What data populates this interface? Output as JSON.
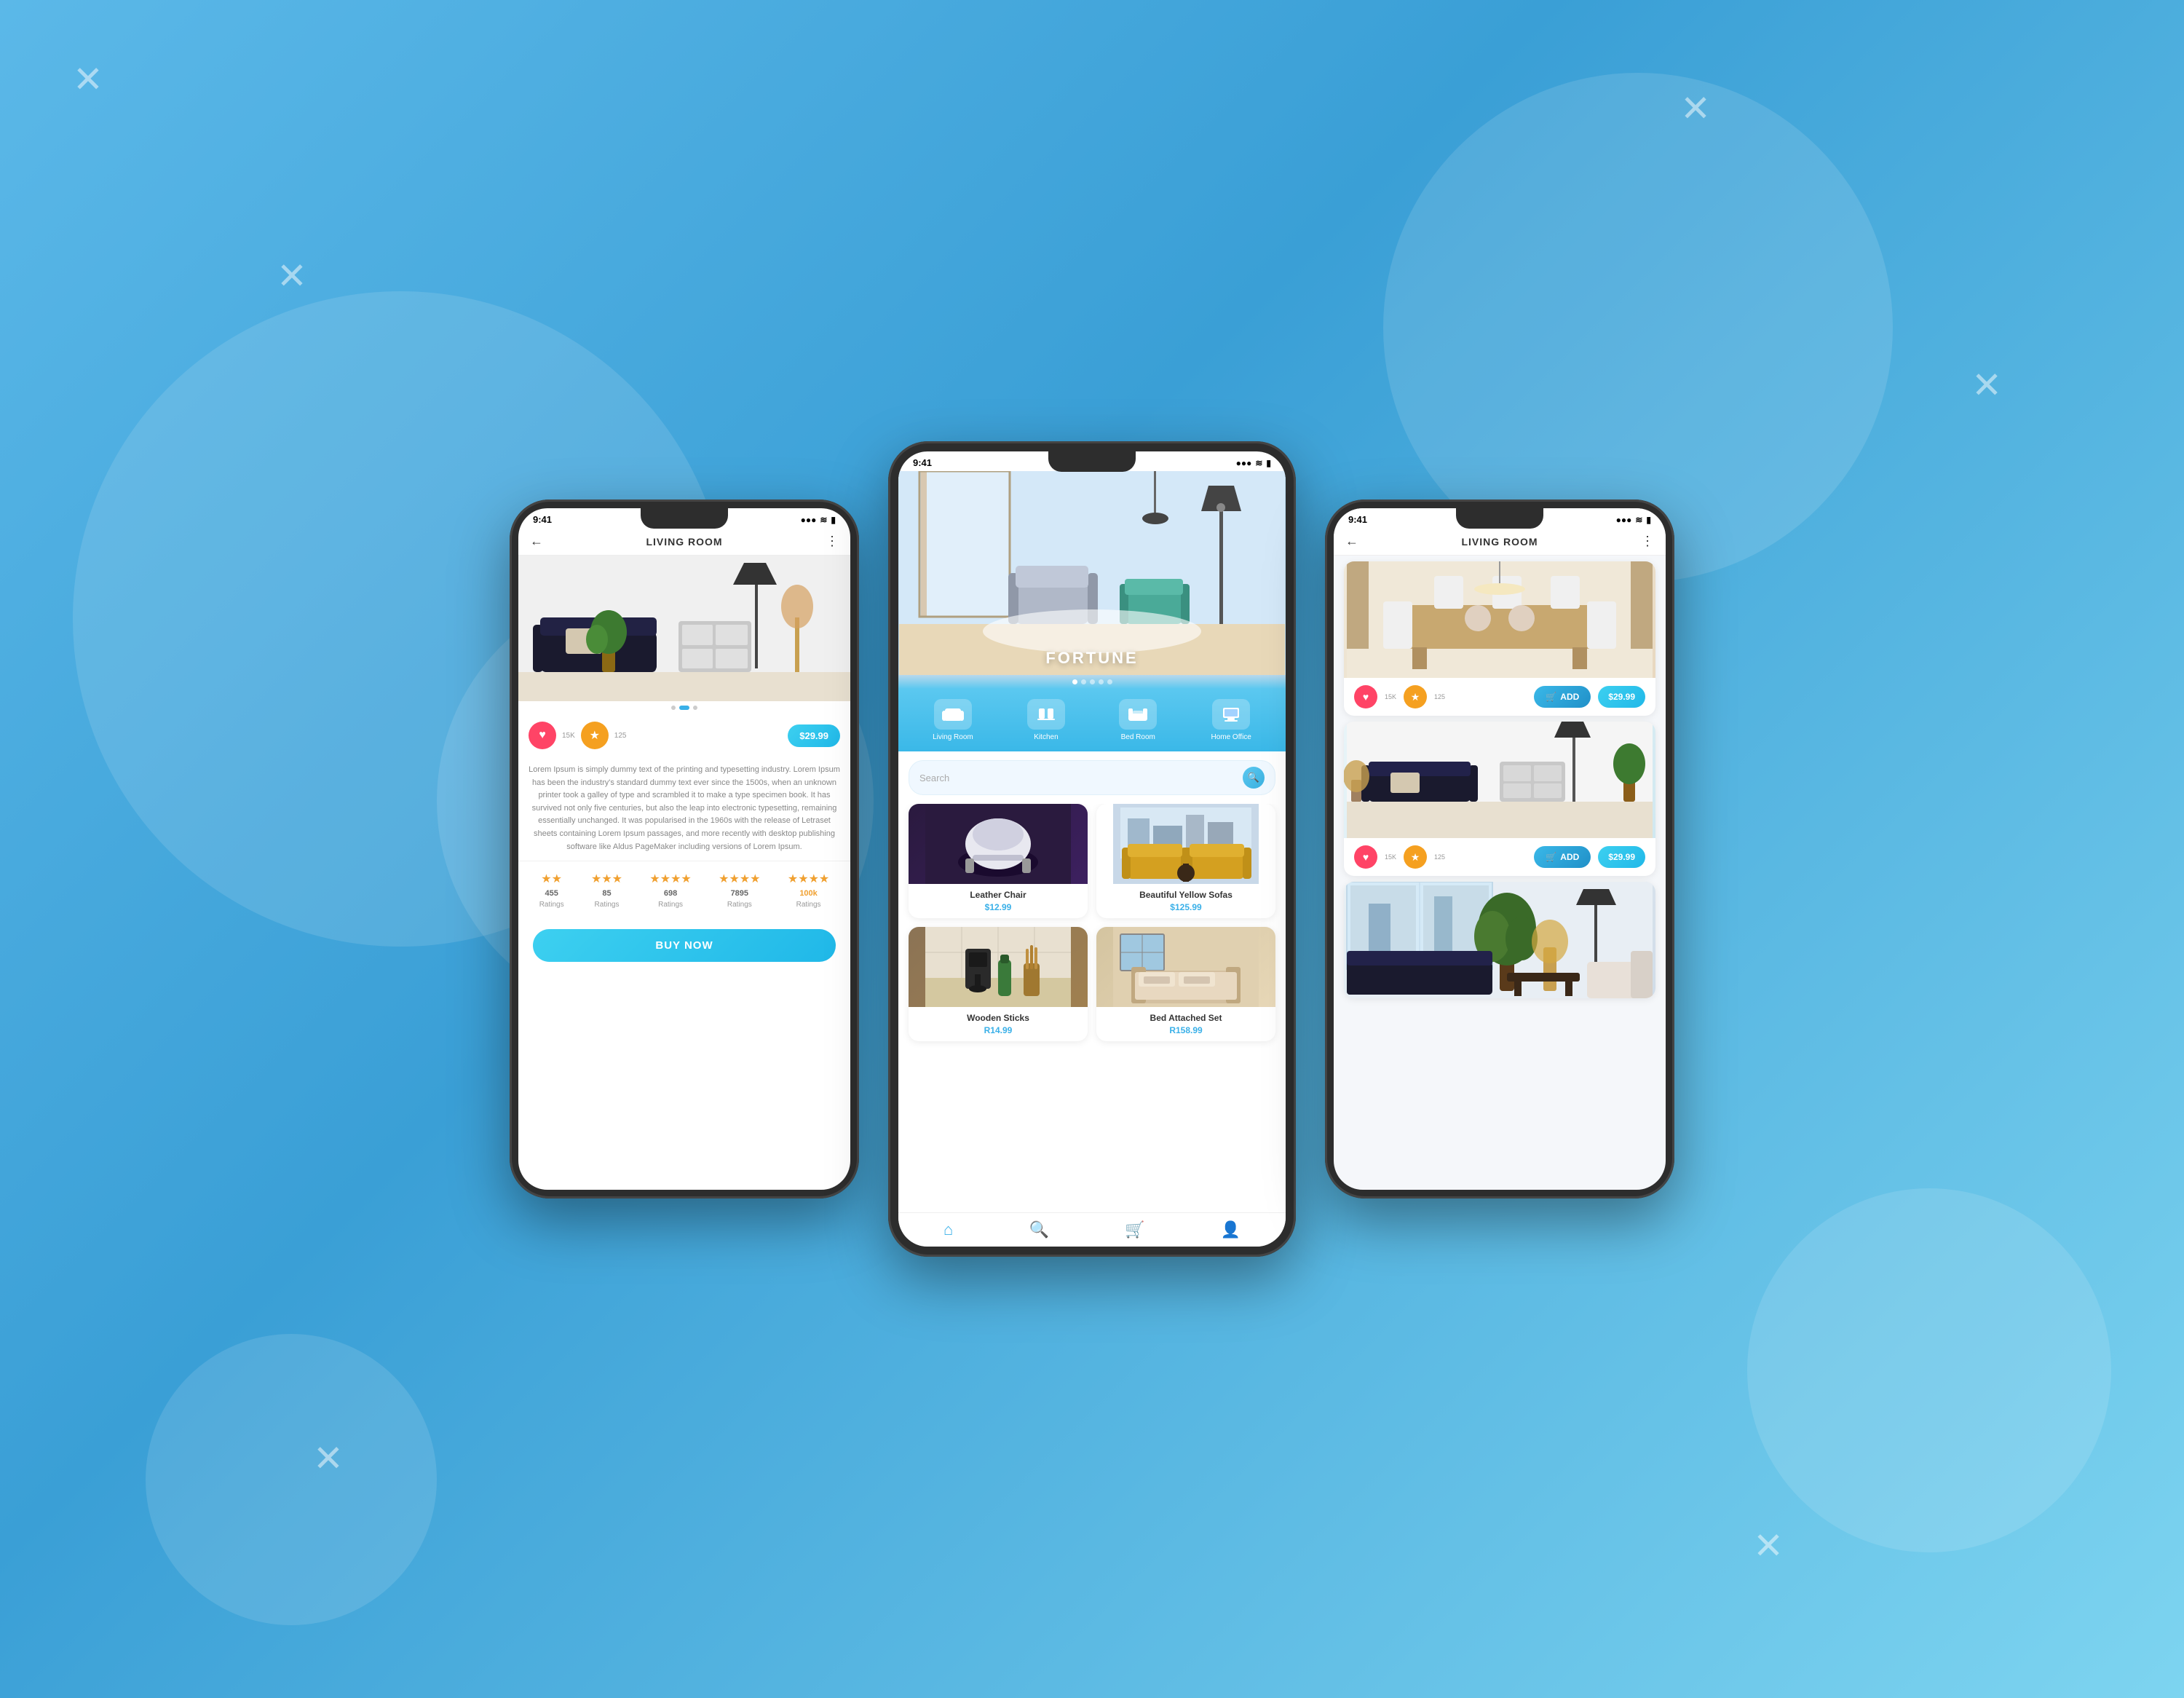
{
  "background": {
    "gradient_start": "#5bb8e8",
    "gradient_end": "#7dd4f0"
  },
  "phone_left": {
    "status": {
      "time": "9:41",
      "signal": "●●●",
      "wifi": "WiFi",
      "battery": "🔋"
    },
    "header": {
      "title": "LIVING ROOM",
      "back": "←",
      "menu": "⋮"
    },
    "hero": {
      "image_alt": "Living room with sofa and dresser"
    },
    "action_bar": {
      "like_count": "15K",
      "star_count": "125",
      "price": "$29.99"
    },
    "description": "Lorem Ipsum is simply dummy text of the printing and typesetting industry. Lorem Ipsum has been the industry's standard dummy text ever since the 1500s, when an unknown printer took a galley of type and scrambled it to make a type specimen book. It has survived not only five centuries, but also the leap into electronic typesetting, remaining essentially unchanged. It was popularised in the 1960s with the release of Letraset sheets containing Lorem Ipsum passages, and more recently with desktop publishing software like Aldus PageMaker including versions of Lorem Ipsum.",
    "ratings": [
      {
        "count": "455",
        "label": "Ratings",
        "stars": 2,
        "active": false
      },
      {
        "count": "85",
        "label": "Ratings",
        "stars": 3,
        "active": false
      },
      {
        "count": "698",
        "label": "Ratings",
        "stars": 4,
        "active": false
      },
      {
        "count": "7895",
        "label": "Ratings",
        "stars": 4,
        "active": false
      },
      {
        "count": "100k",
        "label": "Ratings",
        "stars": 4,
        "active": true
      }
    ],
    "buy_now": "BUY NOW"
  },
  "phone_center": {
    "status": {
      "time": "9:41",
      "signal": "●●●",
      "wifi": "WiFi",
      "battery": "🔋"
    },
    "hero": {
      "title": "FORTUNE",
      "slide_dots": [
        1,
        2,
        3,
        4,
        5
      ]
    },
    "categories": [
      {
        "icon": "🛋",
        "label": "Living Room"
      },
      {
        "icon": "🍽",
        "label": "Kitchen"
      },
      {
        "icon": "🛏",
        "label": "Bed Room"
      },
      {
        "icon": "🖥",
        "label": "Home Office"
      }
    ],
    "search": {
      "placeholder": "Search"
    },
    "products": [
      {
        "name": "Leather Chair",
        "price": "$12.99",
        "img_type": "chair"
      },
      {
        "name": "Beautiful Yellow Sofas",
        "price": "$125.99",
        "img_type": "sofas"
      },
      {
        "name": "Wooden Sticks",
        "price": "R14.99",
        "img_type": "wooden"
      },
      {
        "name": "Bed Attached Set",
        "price": "R158.99",
        "img_type": "bed"
      }
    ],
    "nav": [
      {
        "icon": "🏠",
        "label": "Home",
        "active": true
      },
      {
        "icon": "🔍",
        "label": "Search",
        "active": false
      },
      {
        "icon": "🛒",
        "label": "Cart",
        "active": false
      },
      {
        "icon": "👤",
        "label": "Profile",
        "active": false
      }
    ]
  },
  "phone_right": {
    "status": {
      "time": "9:41",
      "signal": "●●●",
      "wifi": "WiFi",
      "battery": "🔋"
    },
    "header": {
      "title": "LIVING ROOM",
      "back": "←",
      "menu": "⋮"
    },
    "products": [
      {
        "img_type": "dining",
        "like_count": "15K",
        "star_count": "125",
        "add_label": "ADD",
        "price": "$29.99"
      },
      {
        "img_type": "living",
        "like_count": "15K",
        "star_count": "125",
        "add_label": "ADD",
        "price": "$29.99"
      },
      {
        "img_type": "modern",
        "like_count": "",
        "star_count": "",
        "add_label": "",
        "price": ""
      }
    ]
  }
}
